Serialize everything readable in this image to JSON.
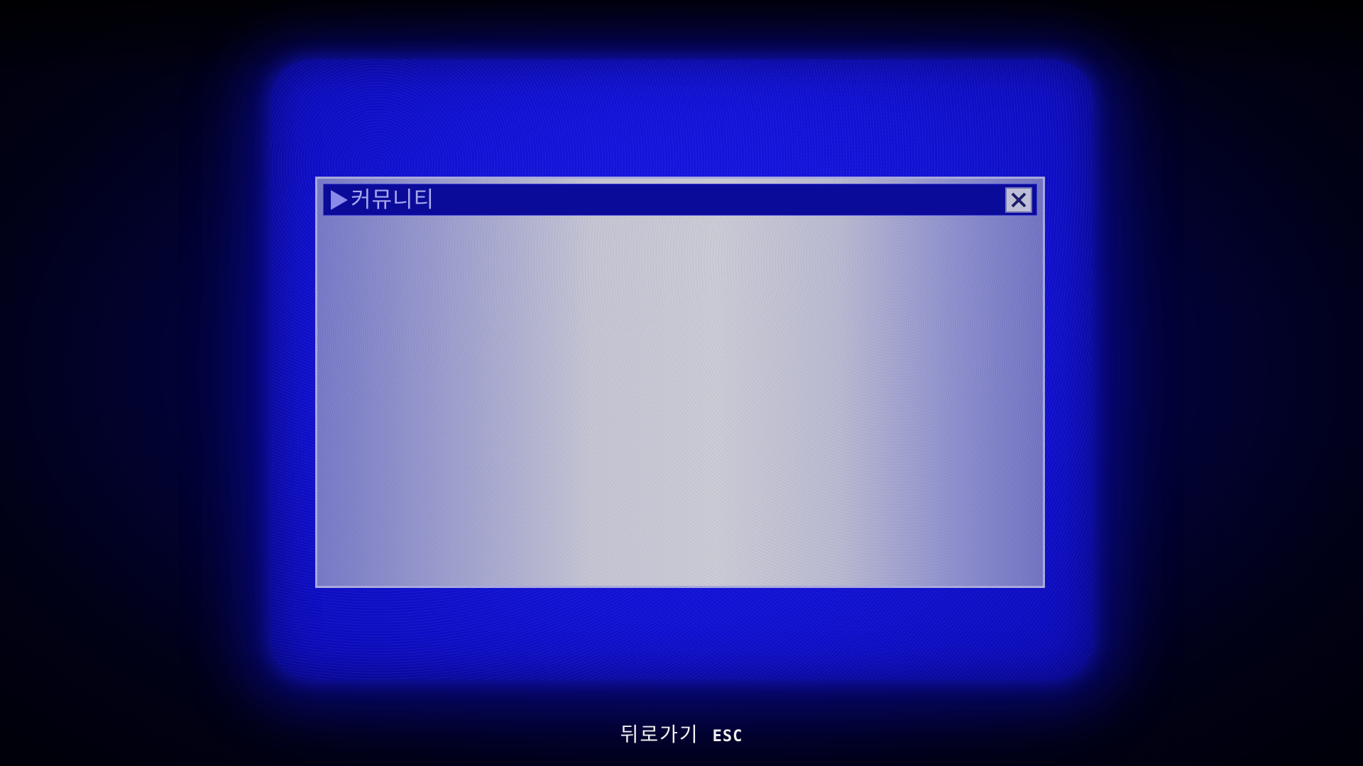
{
  "window": {
    "title_arrow_glyph": "▶",
    "title": "커뮤니티",
    "close_icon": "close-icon"
  },
  "footer": {
    "back_label": "뒤로가기",
    "back_key": "ESC"
  },
  "colors": {
    "screen_blue": "#1414e0",
    "titlebar": "#0b0b9a",
    "title_text": "#a8a8ee",
    "window_center": "#cacad4",
    "window_edge": "#7476c6",
    "hint_text": "#f2f2f2"
  }
}
